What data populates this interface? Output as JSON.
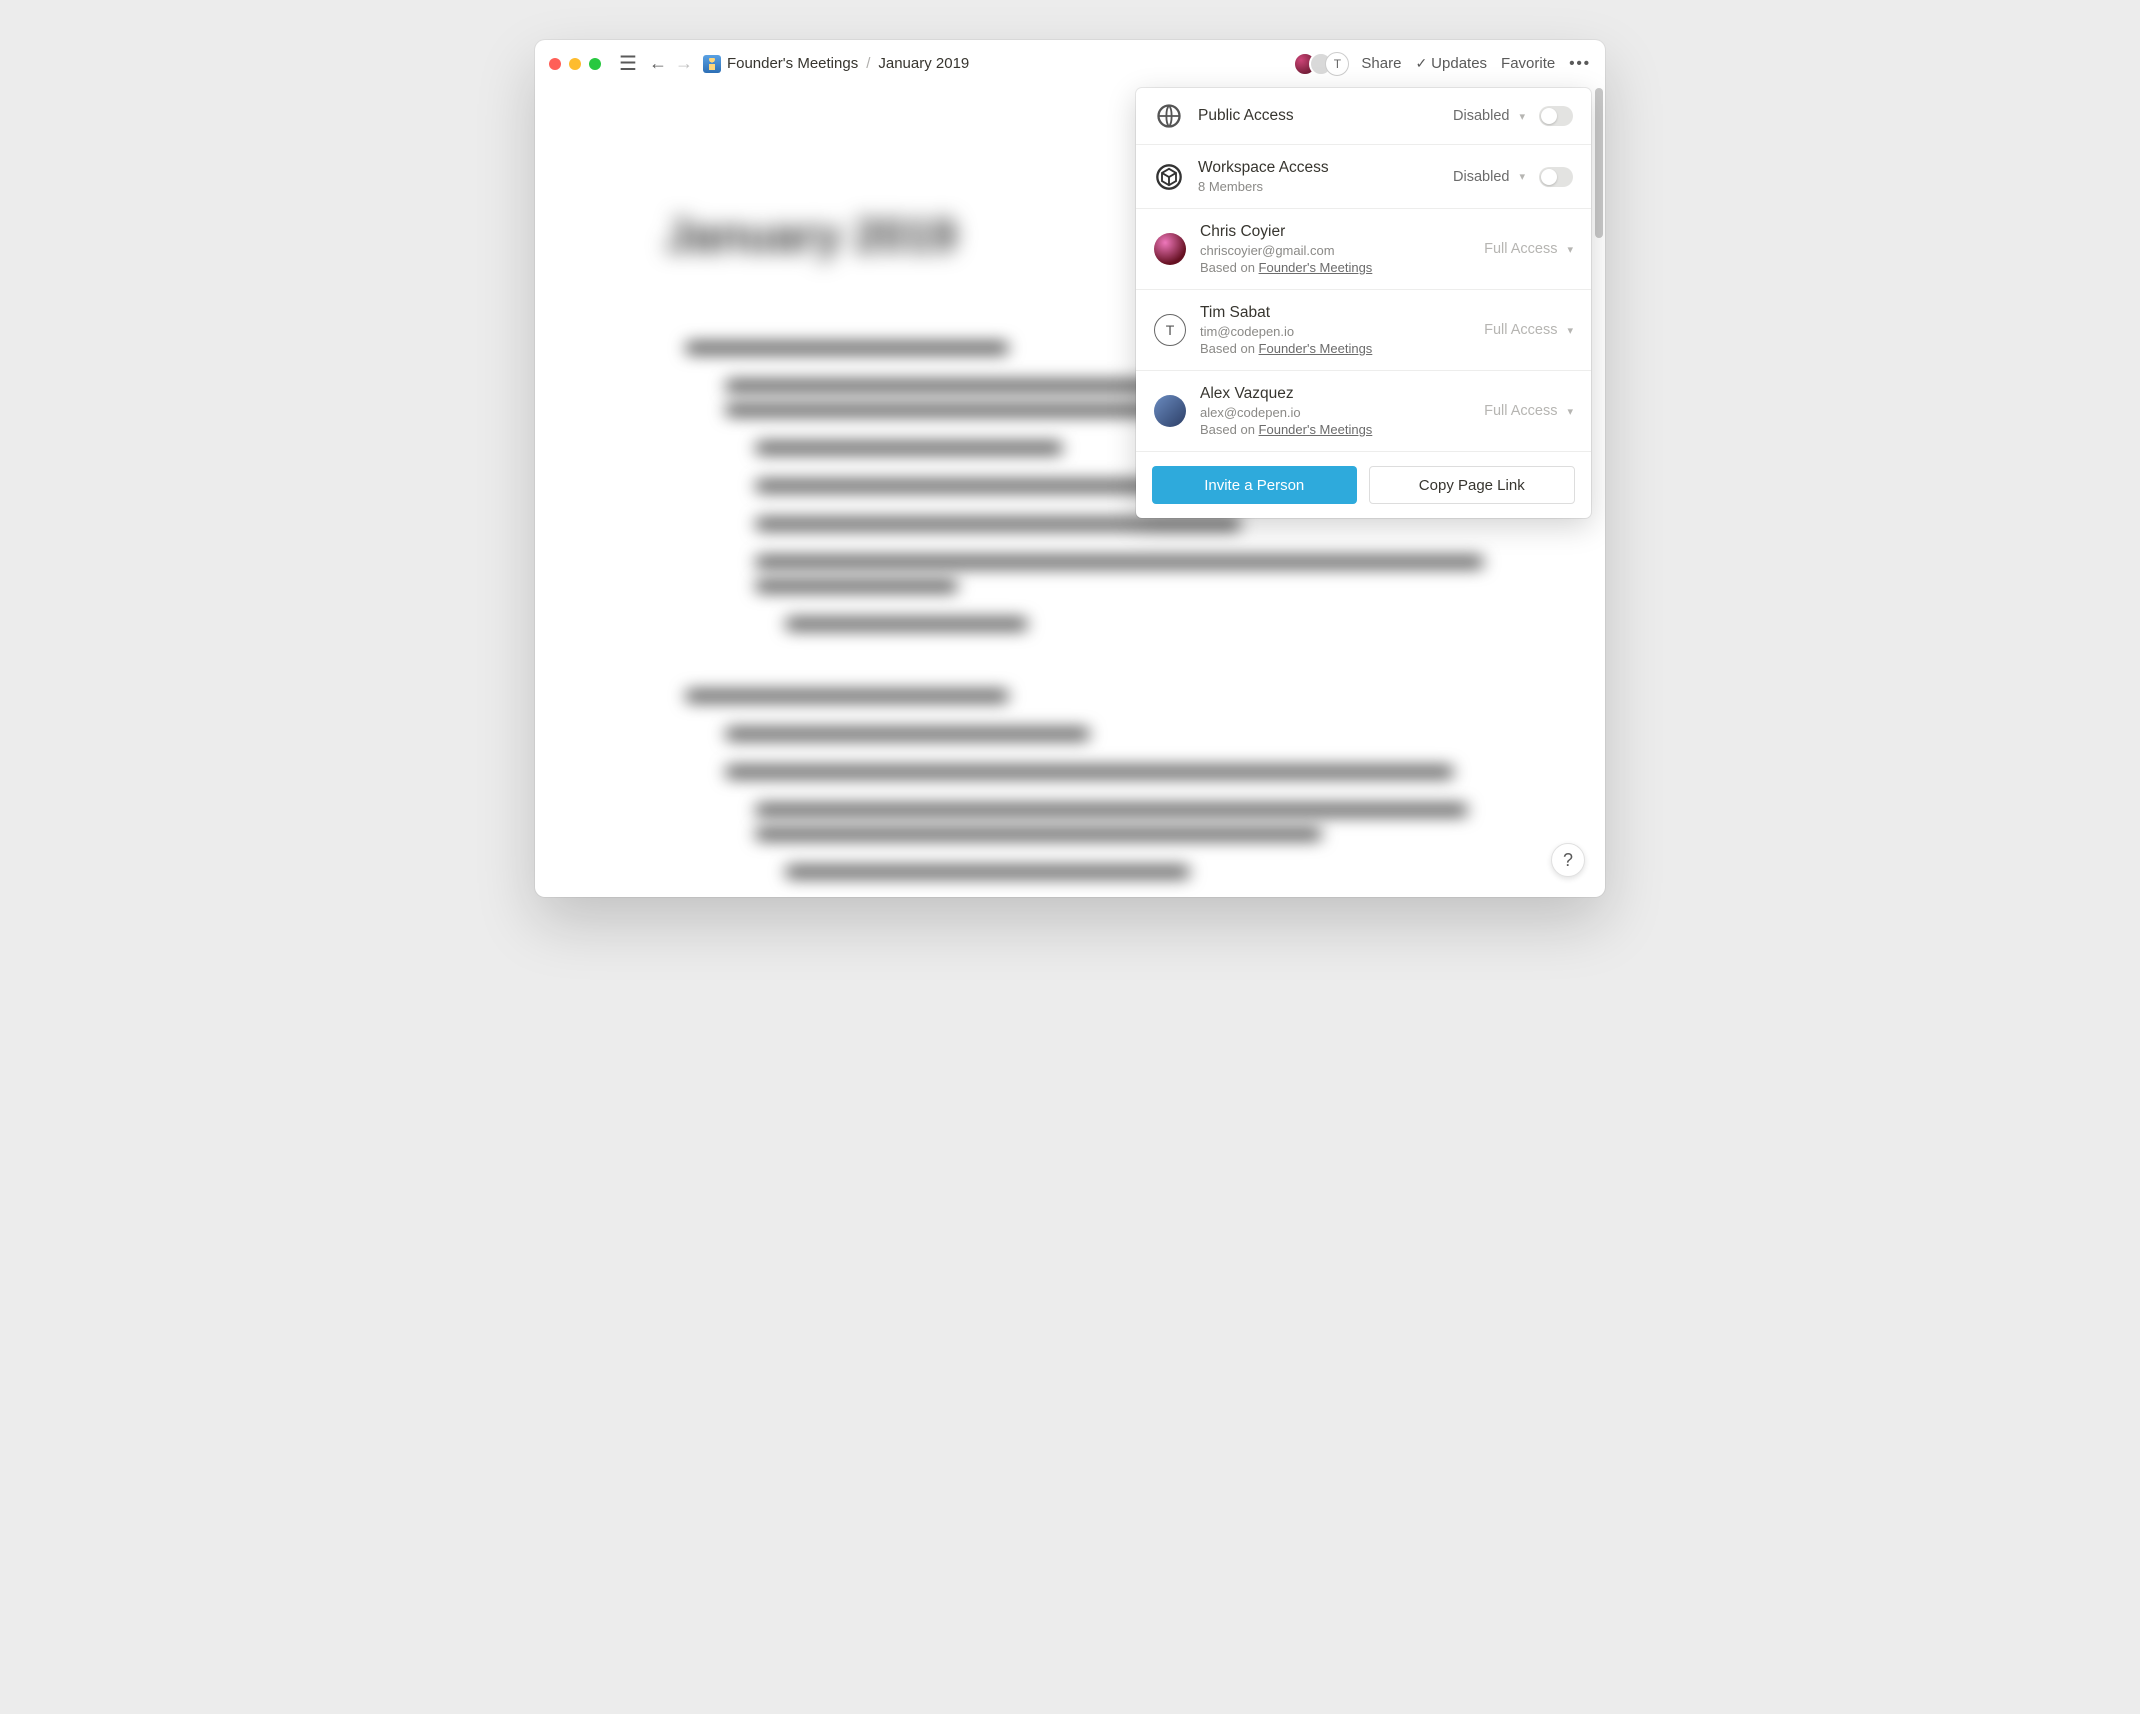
{
  "breadcrumb": {
    "parent": "Founder's Meetings",
    "current": "January 2019",
    "separator": "/"
  },
  "topbar": {
    "share": "Share",
    "updates": "Updates",
    "favorite": "Favorite",
    "more": "•••"
  },
  "presence": {
    "initials": [
      "",
      "",
      "T"
    ]
  },
  "page": {
    "title": "January 2019"
  },
  "share_panel": {
    "public": {
      "label": "Public Access",
      "state": "Disabled",
      "toggle_on": false
    },
    "workspace": {
      "label": "Workspace Access",
      "sub": "8 Members",
      "state": "Disabled",
      "toggle_on": false
    },
    "based_on_prefix": "Based on ",
    "based_on_link": "Founder's Meetings",
    "users": [
      {
        "name": "Chris Coyier",
        "email": "chriscoyier@gmail.com",
        "access": "Full Access",
        "avatar_style": "photo1",
        "initial": ""
      },
      {
        "name": "Tim Sabat",
        "email": "tim@codepen.io",
        "access": "Full Access",
        "avatar_style": "outline",
        "initial": "T"
      },
      {
        "name": "Alex Vazquez",
        "email": "alex@codepen.io",
        "access": "Full Access",
        "avatar_style": "photo2",
        "initial": ""
      }
    ],
    "invite_btn": "Invite a Person",
    "copy_btn": "Copy Page Link"
  },
  "help_label": "?"
}
